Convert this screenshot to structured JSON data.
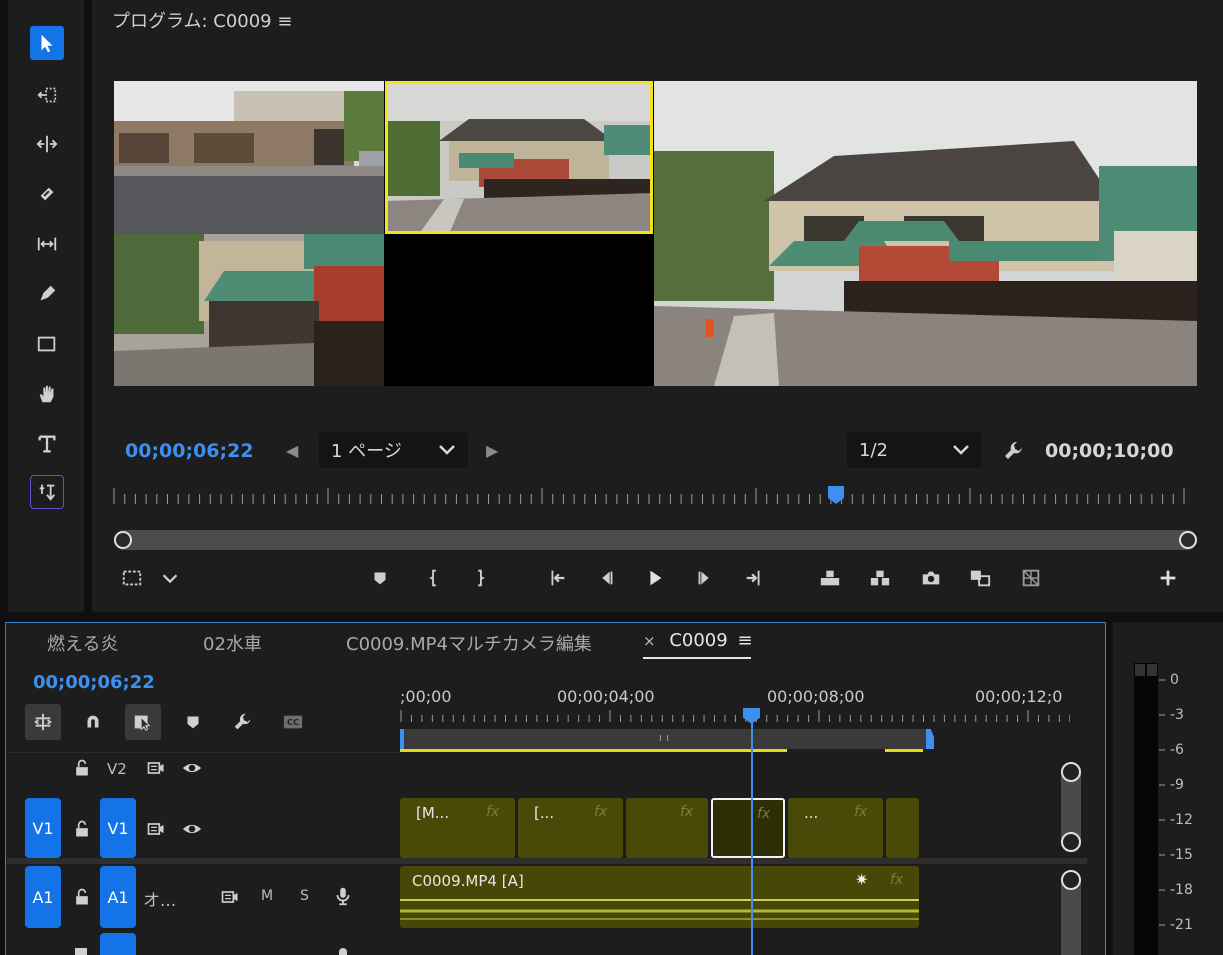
{
  "program_monitor": {
    "title": "プログラム: C0009",
    "current_timecode": "00;00;06;22",
    "page_select": "1 ページ",
    "resolution_select": "1/2",
    "duration_timecode": "00;00;10;00"
  },
  "timeline": {
    "tabs": [
      "燃える炎",
      "02水車",
      "C0009.MP4マルチカメラ編集",
      "C0009"
    ],
    "active_tab_close": "×",
    "current_timecode": "00;00;06;22",
    "ruler_labels": [
      ";00;00",
      "00;00;04;00",
      "00;00;08;00",
      "00;00;12;0"
    ],
    "tracks": {
      "v2": {
        "label": "V2"
      },
      "v1": {
        "source": "V1",
        "label": "V1"
      },
      "a1": {
        "source": "A1",
        "label": "A1",
        "name": "オ...",
        "mute": "M",
        "solo": "S"
      }
    },
    "clips": {
      "v1": [
        "[M...",
        "[...",
        "",
        "",
        "...",
        ""
      ],
      "fx_label": "fx",
      "a1_name": "C0009.MP4 [A]"
    }
  },
  "audio_meter": {
    "scale": [
      "0",
      "-3",
      "-6",
      "-9",
      "-12",
      "-15",
      "-18",
      "-21"
    ]
  }
}
